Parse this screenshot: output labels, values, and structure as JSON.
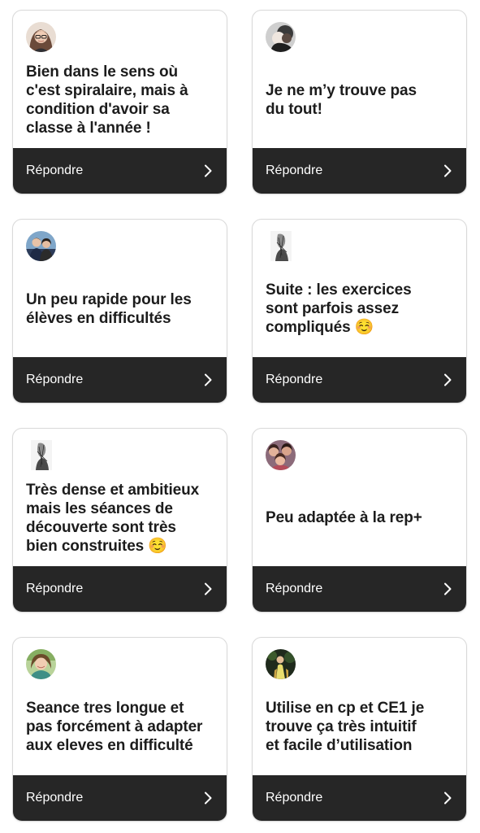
{
  "reply_label": "Répondre",
  "colors": {
    "reply_bar": "#262626",
    "card_border": "#d9d9d9",
    "text": "#1c1c1c"
  },
  "cards": [
    {
      "text": "Bien dans le sens où\nc'est spiralaire, mais à\ncondition d'avoir sa\nclasse à l'année !",
      "avatar": "avatar-woman-glasses"
    },
    {
      "text": "Je ne m’y trouve pas\ndu tout!",
      "avatar": "avatar-dark-portrait"
    },
    {
      "text": "Un peu rapide pour les\nélèves en difficultés",
      "avatar": "avatar-couple"
    },
    {
      "text": "Suite : les exercices\nsont parfois assez\ncompliqués ☺️",
      "avatar": "avatar-sketch"
    },
    {
      "text": "Très dense et ambitieux\nmais les séances de\ndécouverte sont très\nbien construites ☺️",
      "avatar": "avatar-sketch"
    },
    {
      "text": "Peu adaptée à la rep+",
      "avatar": "avatar-group"
    },
    {
      "text": "Seance tres longue et\npas forcément à adapter\naux eleves en difficulté",
      "avatar": "avatar-woman-green"
    },
    {
      "text": "Utilise en cp et CE1 je\ntrouve ça très intuitif\net facile d’utilisation",
      "avatar": "avatar-outdoor"
    }
  ]
}
